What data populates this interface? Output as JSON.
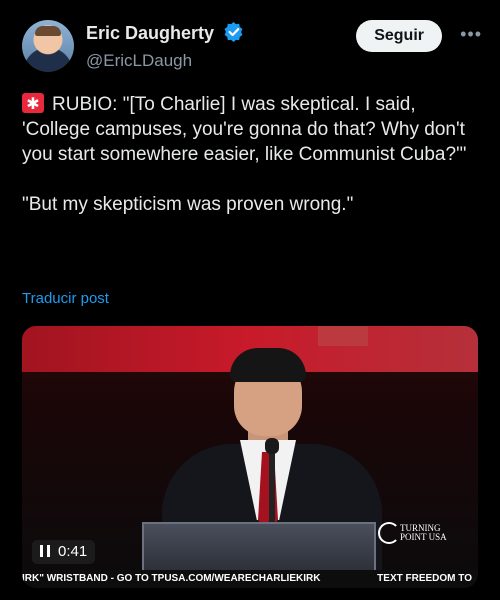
{
  "author": {
    "name": "Eric Daugherty",
    "handle": "@EricLDaugh",
    "verified": true,
    "avatar_icon": "profile-photo"
  },
  "actions": {
    "follow_label": "Seguir",
    "more_label": "•••"
  },
  "tweet": {
    "emoji_icon": "siren-icon",
    "paragraph_1": "RUBIO: \"[To Charlie] I was skeptical. I said, 'College campuses, you're gonna do that? Why don't you start somewhere easier, like Communist Cuba?'\"",
    "paragraph_2": "\"But my skepticism was proven wrong.\""
  },
  "translate_label": "Traducir post",
  "video": {
    "time": "0:41",
    "state_icon": "pause-icon",
    "logo_line1": "TURNING",
    "logo_line2": "POINT USA",
    "ticker_left": "IRK\" WRISTBAND - GO TO TPUSA.COM/WEARECHARLIEKIRK",
    "ticker_right": "TEXT FREEDOM TO"
  },
  "colors": {
    "background": "#000000",
    "link": "#1d9bf0",
    "verified": "#1d9bf0",
    "follow_bg": "#eff3f4"
  }
}
